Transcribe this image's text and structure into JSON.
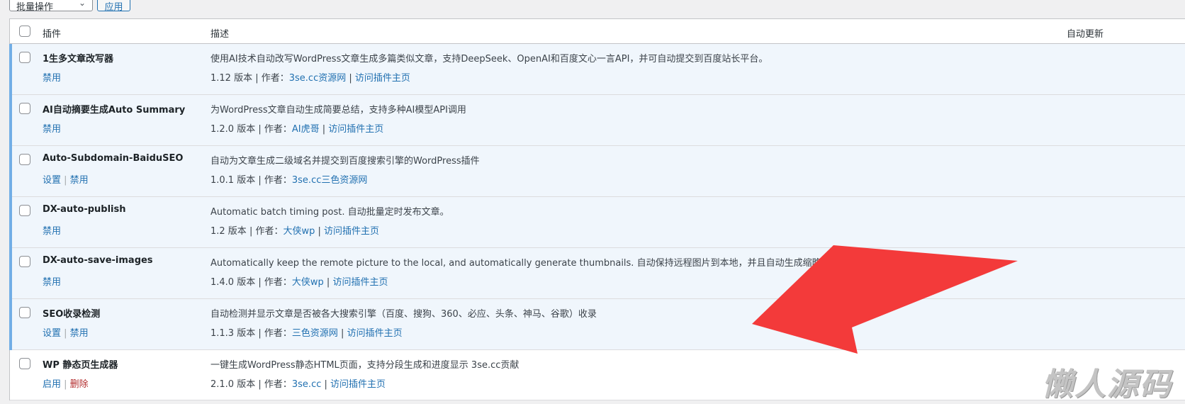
{
  "toolbar": {
    "bulk_action": "批量操作",
    "apply": "应用"
  },
  "table": {
    "headers": {
      "plugin": "插件",
      "description": "描述",
      "auto_update": "自动更新"
    },
    "rows": [
      {
        "name": "1生多文章改写器",
        "actions": [
          {
            "label": "禁用",
            "type": "normal"
          }
        ],
        "description": "使用AI技术自动改写WordPress文章生成多篇类似文章，支持DeepSeek、OpenAI和百度文心一言API，并可自动提交到百度站长平台。",
        "version": "1.12 版本",
        "author_label": "作者：",
        "author": "3se.cc资源网",
        "homepage": "访问插件主页",
        "active": true
      },
      {
        "name": "AI自动摘要生成Auto Summary",
        "actions": [
          {
            "label": "禁用",
            "type": "normal"
          }
        ],
        "description": "为WordPress文章自动生成简要总结，支持多种AI模型API调用",
        "version": "1.2.0 版本",
        "author_label": "作者：",
        "author": "AI虎哥",
        "homepage": "访问插件主页",
        "active": true
      },
      {
        "name": "Auto-Subdomain-BaiduSEO",
        "actions": [
          {
            "label": "设置",
            "type": "normal"
          },
          {
            "label": "禁用",
            "type": "normal"
          }
        ],
        "description": "自动为文章生成二级域名并提交到百度搜索引擎的WordPress插件",
        "version": "1.0.1 版本",
        "author_label": "作者：",
        "author": "3se.cc三色资源网",
        "homepage": "",
        "active": true
      },
      {
        "name": "DX-auto-publish",
        "actions": [
          {
            "label": "禁用",
            "type": "normal"
          }
        ],
        "description": "Automatic batch timing post. 自动批量定时发布文章。",
        "version": "1.2 版本",
        "author_label": "作者：",
        "author": "大侠wp",
        "homepage": "访问插件主页",
        "active": true
      },
      {
        "name": "DX-auto-save-images",
        "actions": [
          {
            "label": "禁用",
            "type": "normal"
          }
        ],
        "description": "Automatically keep the remote picture to the local, and automatically generate thumbnails. 自动保持远程图片到本地，并且自动生成缩略图。",
        "version": "1.4.0 版本",
        "author_label": "作者：",
        "author": "大侠wp",
        "homepage": "访问插件主页",
        "active": true
      },
      {
        "name": "SEO收录检测",
        "actions": [
          {
            "label": "设置",
            "type": "normal"
          },
          {
            "label": "禁用",
            "type": "normal"
          }
        ],
        "description": "自动检测并显示文章是否被各大搜索引擎（百度、搜狗、360、必应、头条、神马、谷歌）收录",
        "version": "1.1.3 版本",
        "author_label": "作者：",
        "author": "三色资源网",
        "homepage": "访问插件主页",
        "active": true
      },
      {
        "name": "WP 静态页生成器",
        "actions": [
          {
            "label": "启用",
            "type": "normal"
          },
          {
            "label": "删除",
            "type": "danger"
          }
        ],
        "description": "一键生成WordPress静态HTML页面，支持分段生成和进度显示 3se.cc贡献",
        "version": "2.1.0 版本",
        "author_label": "作者：",
        "author": "3se.cc",
        "homepage": "访问插件主页",
        "active": false
      }
    ]
  },
  "overlay": {
    "arrow_color": "#f33a3a",
    "watermark": "懒人源码"
  }
}
